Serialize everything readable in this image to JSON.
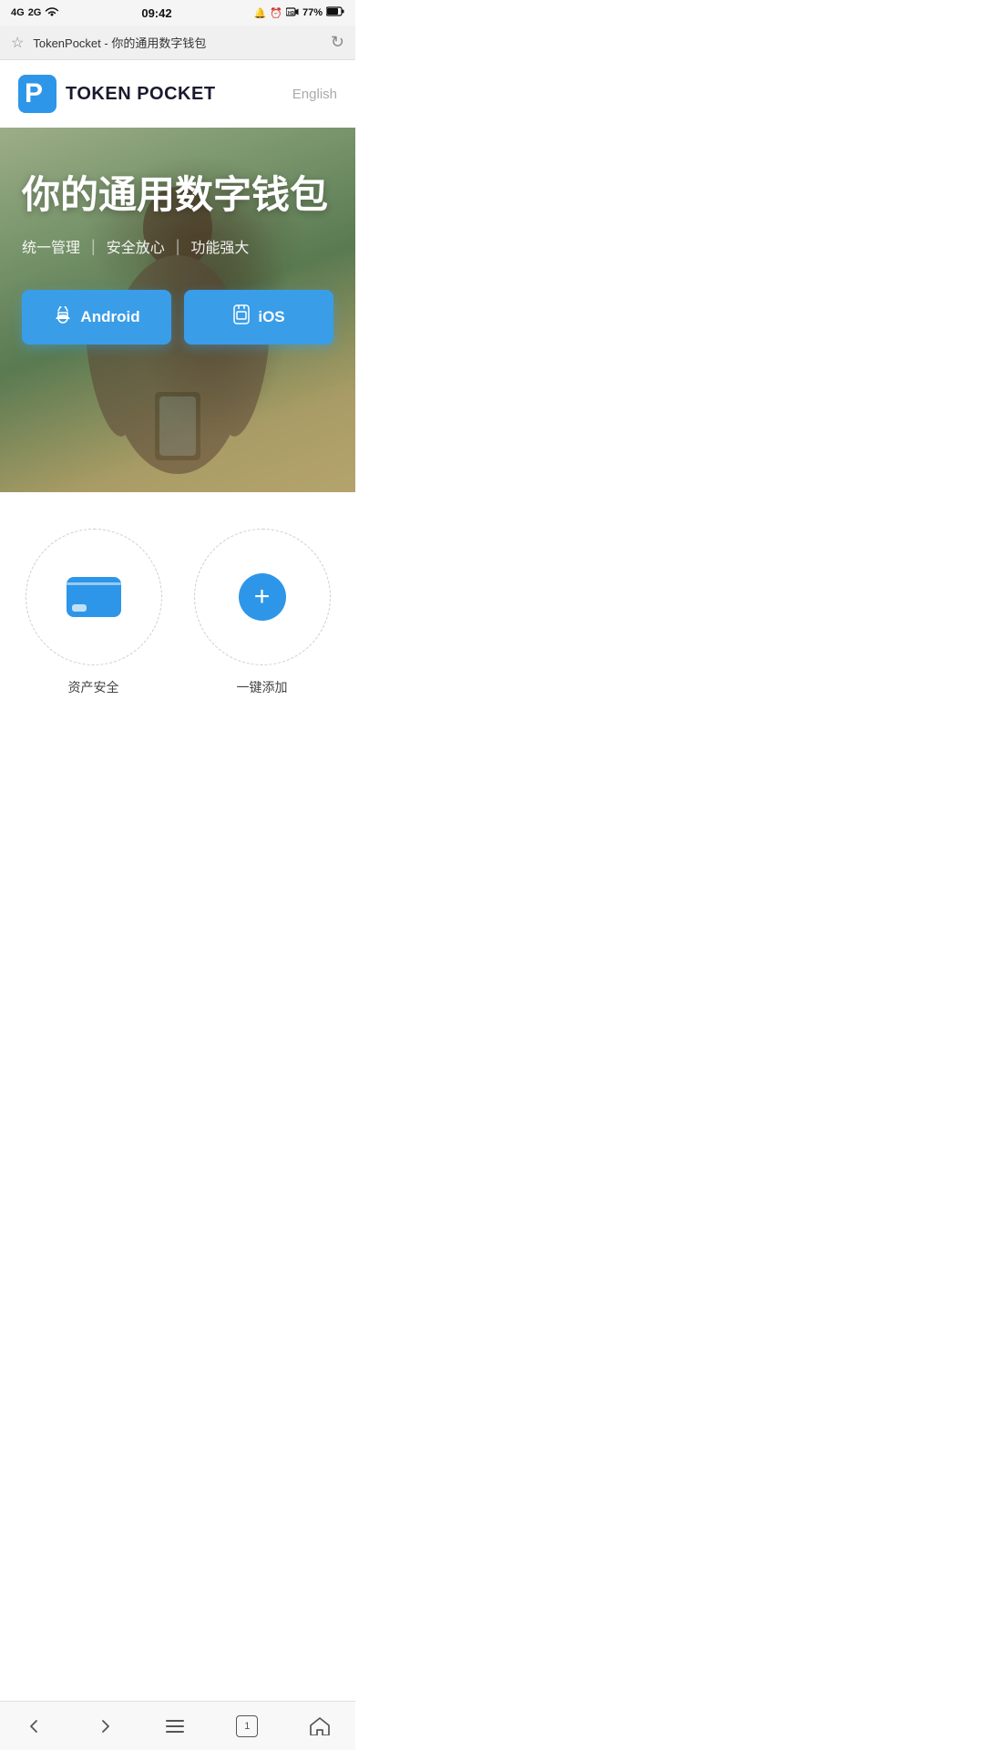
{
  "status": {
    "time": "09:42",
    "signal_4g": "4G",
    "signal_2g": "2G",
    "wifi": true,
    "battery": "77%",
    "bell": true,
    "clock": true,
    "hd_call": true
  },
  "browser": {
    "url": "TokenPocket - 你的通用数字钱包",
    "star_label": "★",
    "refresh_label": "↻"
  },
  "header": {
    "logo_text": "TOKEN POCKET",
    "lang_button": "English"
  },
  "hero": {
    "title": "你的通用数字钱包",
    "subtitle_parts": [
      "统一管理",
      "安全放心",
      "功能强大"
    ],
    "android_btn": "Android",
    "ios_btn": "iOS"
  },
  "features": [
    {
      "icon": "wallet",
      "label": "资产安全"
    },
    {
      "icon": "plus",
      "label": "一键添加"
    }
  ],
  "bottom_nav": {
    "back": "‹",
    "forward": "›",
    "menu": "≡",
    "tab_count": "1",
    "home": "⌂"
  }
}
